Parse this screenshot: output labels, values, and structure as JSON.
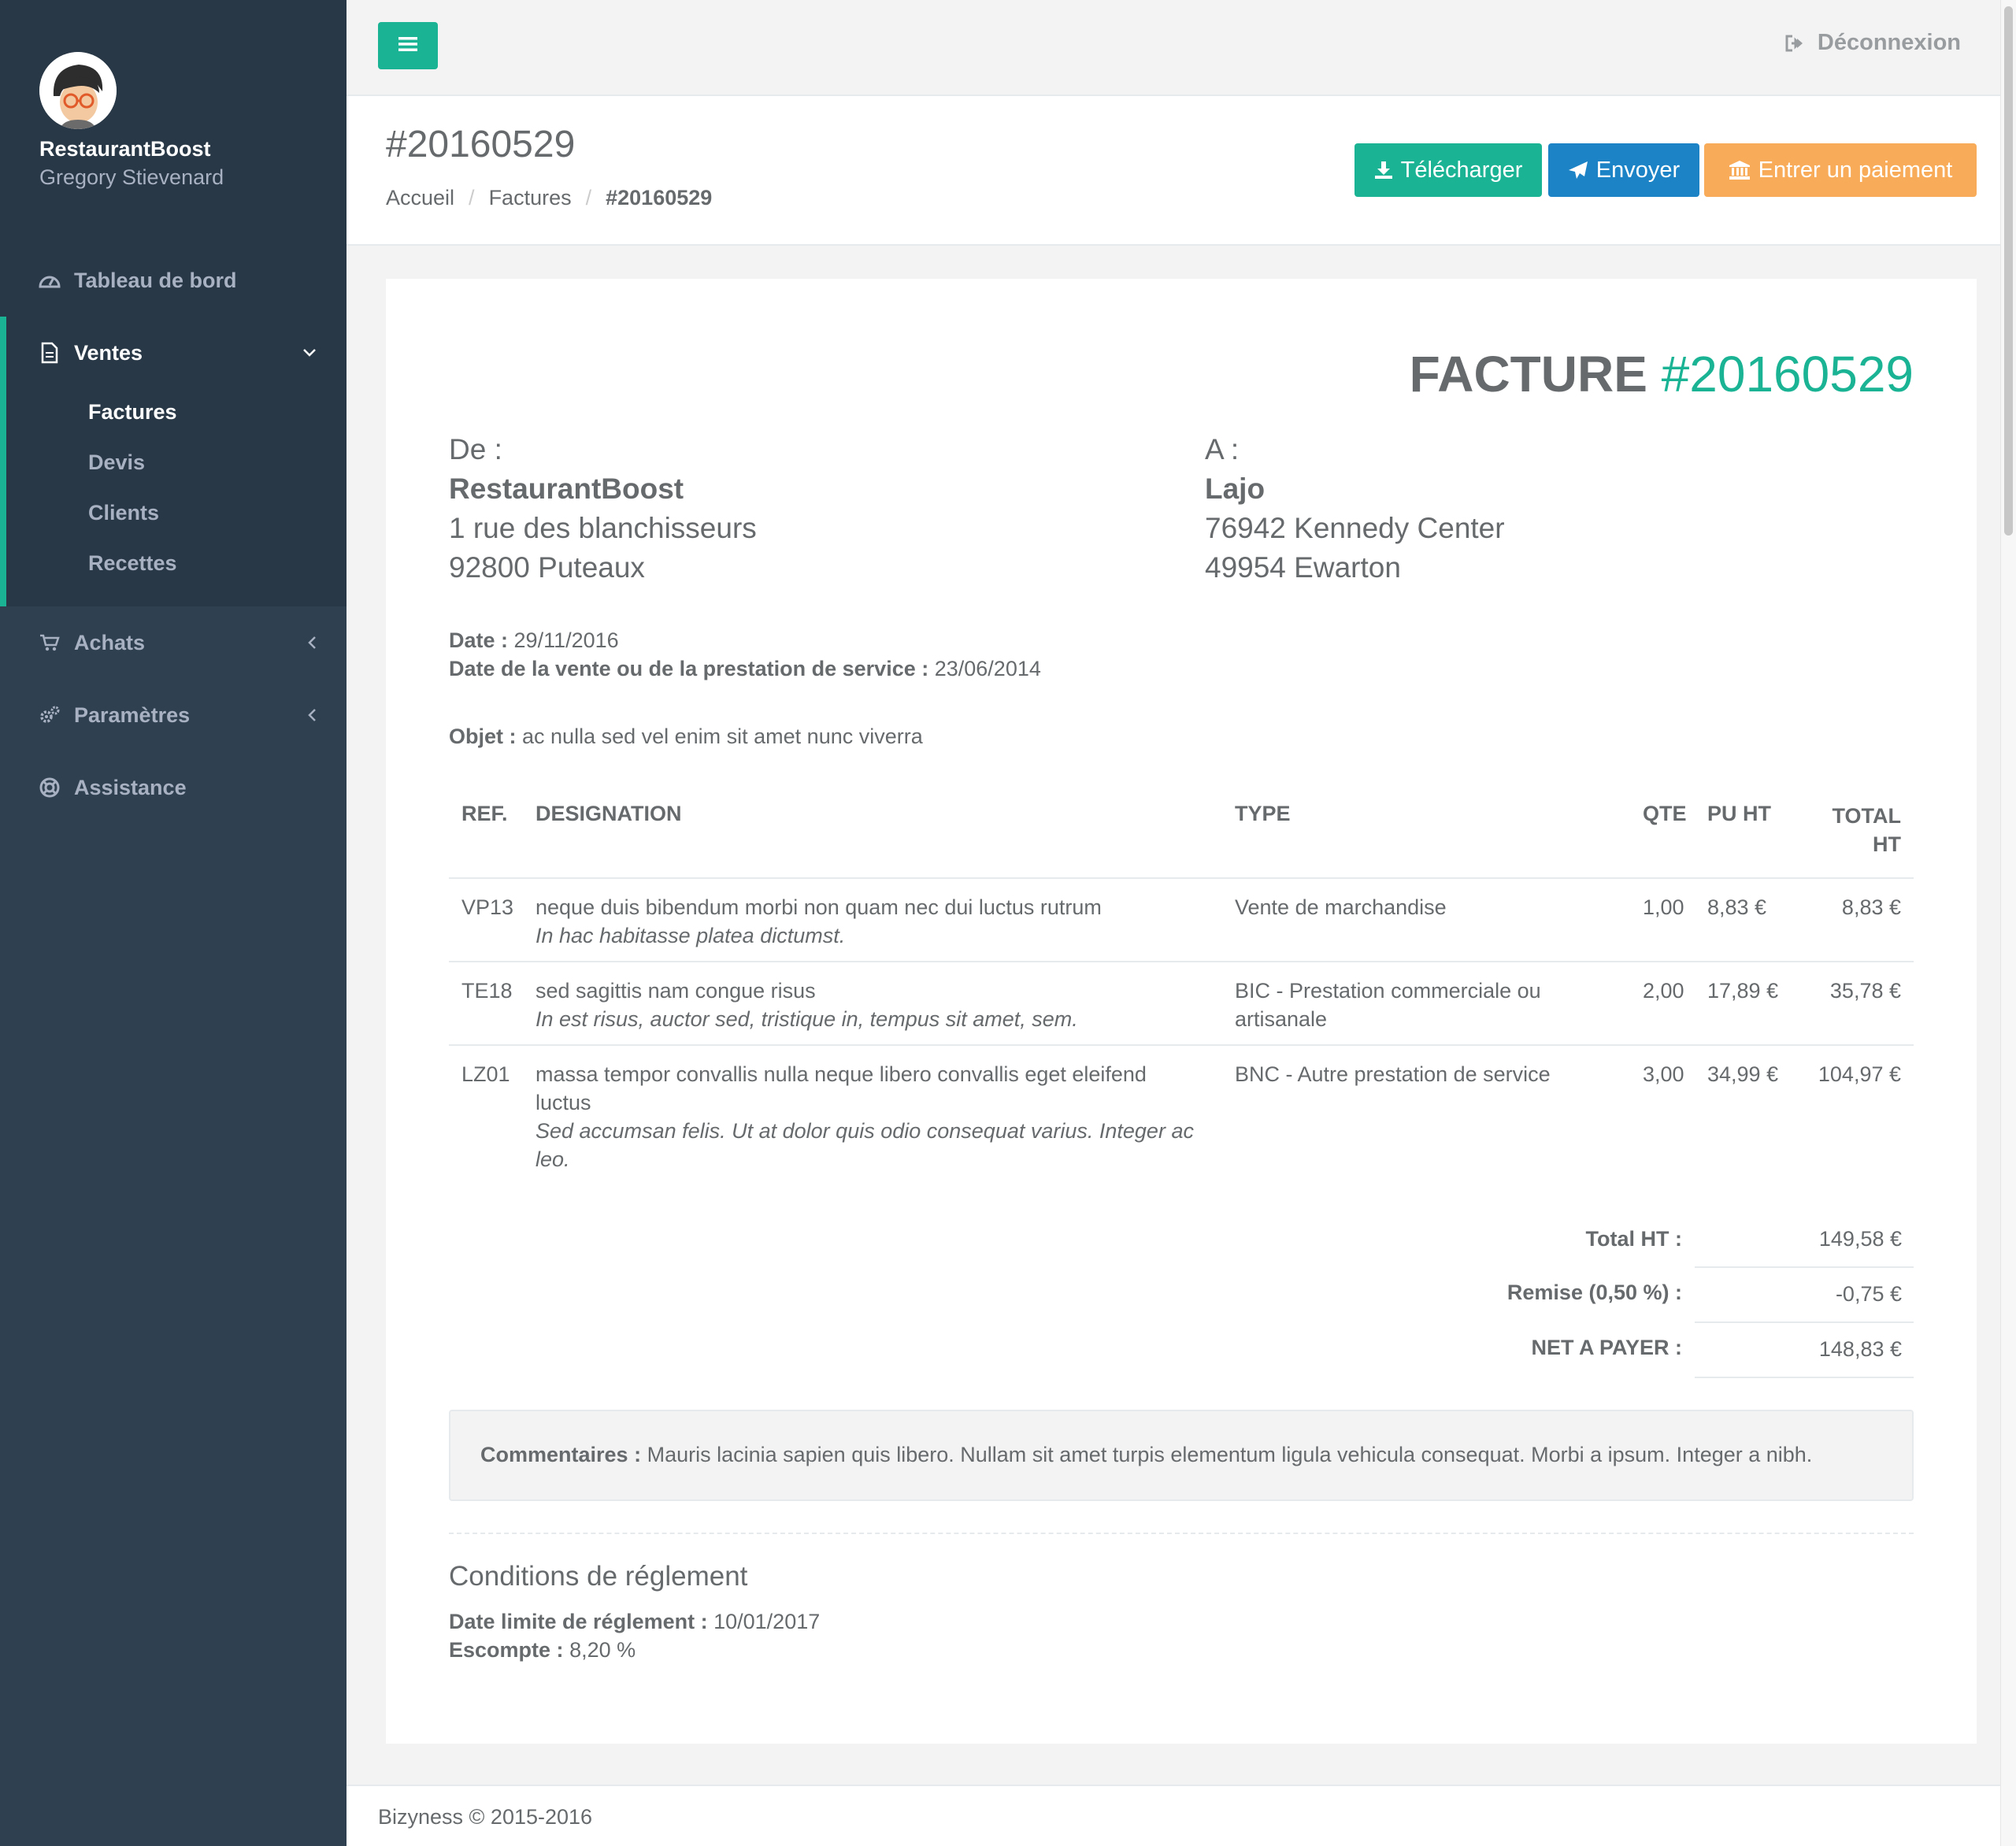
{
  "sidebar": {
    "brand": "RestaurantBoost",
    "user": "Gregory Stievenard",
    "items": [
      {
        "label": "Tableau de bord",
        "icon": "dashboard-icon"
      },
      {
        "label": "Ventes",
        "icon": "file-icon",
        "expanded": true,
        "children": [
          "Factures",
          "Devis",
          "Clients",
          "Recettes"
        ],
        "active_child": "Factures"
      },
      {
        "label": "Achats",
        "icon": "cart-icon"
      },
      {
        "label": "Paramètres",
        "icon": "cogs-icon"
      },
      {
        "label": "Assistance",
        "icon": "lifebuoy-icon"
      }
    ]
  },
  "topbar": {
    "logout": "Déconnexion"
  },
  "heading": {
    "title": "#20160529",
    "breadcrumb": [
      "Accueil",
      "Factures",
      "#20160529"
    ],
    "buttons": {
      "download": "Télécharger",
      "send": "Envoyer",
      "payment": "Entrer un paiement"
    }
  },
  "invoice": {
    "title_word": "FACTURE",
    "title_number": "#20160529",
    "from": {
      "label": "De :",
      "name": "RestaurantBoost",
      "line1": "1 rue des blanchisseurs",
      "line2": "92800 Puteaux"
    },
    "to": {
      "label": "A :",
      "name": "Lajo",
      "line1": "76942 Kennedy Center",
      "line2": "49954 Ewarton"
    },
    "date_label": "Date :",
    "date": "29/11/2016",
    "sale_date_label": "Date de la vente ou de la prestation de service :",
    "sale_date": "23/06/2014",
    "object_label": "Objet :",
    "object": "ac nulla sed vel enim sit amet nunc viverra",
    "columns": {
      "ref": "REF.",
      "designation": "DESIGNATION",
      "type": "TYPE",
      "qty": "QTE",
      "pu": "PU HT",
      "total1": "TOTAL",
      "total2": "HT"
    },
    "rows": [
      {
        "ref": "VP13",
        "desc": "neque duis bibendum morbi non quam nec dui luctus rutrum",
        "desc2": "",
        "note": "In hac habitasse platea dictumst.",
        "note2": "",
        "type": "Vente de marchandise",
        "type2": "",
        "qty": "1,00",
        "pu": "8,83 €",
        "total": "8,83 €"
      },
      {
        "ref": "TE18",
        "desc": "sed sagittis nam congue risus",
        "desc2": "",
        "note": "In est risus, auctor sed, tristique in, tempus sit amet, sem.",
        "note2": "",
        "type": "BIC - Prestation commerciale ou",
        "type2": "artisanale",
        "qty": "2,00",
        "pu": "17,89 €",
        "total": "35,78 €"
      },
      {
        "ref": "LZ01",
        "desc": "massa tempor convallis nulla neque libero convallis eget eleifend",
        "desc2": "luctus",
        "note": "Sed accumsan felis. Ut at dolor quis odio consequat varius. Integer ac",
        "note2": "leo.",
        "type": "BNC - Autre prestation de service",
        "type2": "",
        "qty": "3,00",
        "pu": "34,99 €",
        "total": "104,97 €"
      }
    ],
    "totals": [
      {
        "label": "Total HT :",
        "value": "149,58 €"
      },
      {
        "label": "Remise (0,50 %) :",
        "value": "-0,75 €"
      },
      {
        "label": "NET A PAYER :",
        "value": "148,83 €"
      }
    ],
    "comments_label": "Commentaires :",
    "comments": "Mauris lacinia sapien quis libero. Nullam sit amet turpis elementum ligula vehicula consequat. Morbi a ipsum. Integer a nibh.",
    "conditions_title": "Conditions de réglement",
    "due_label": "Date limite de réglement :",
    "due": "10/01/2017",
    "discount_label": "Escompte :",
    "discount": "8,20 %"
  },
  "footer": {
    "text": "Bizyness © 2015-2016"
  },
  "colors": {
    "accent": "#1ab394",
    "primary": "#1c84c6",
    "warning": "#f8ac59",
    "sidebar": "#2f4050"
  }
}
